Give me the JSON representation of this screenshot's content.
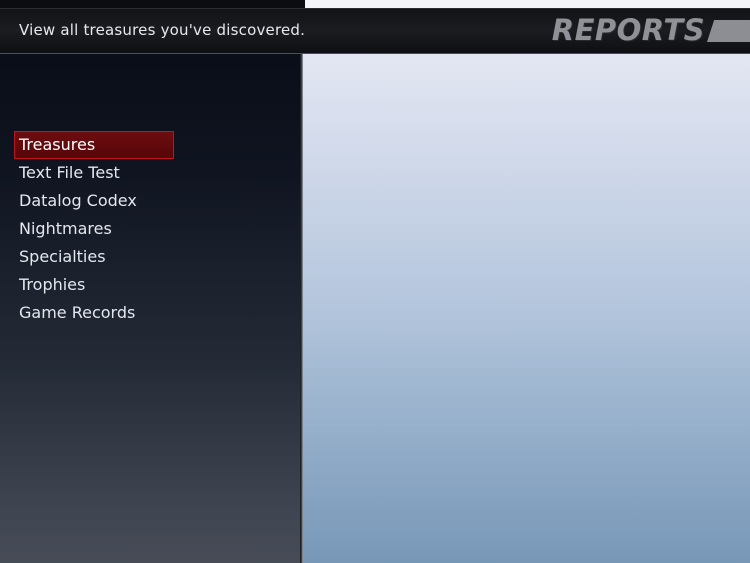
{
  "header": {
    "hint": "View all treasures you've discovered.",
    "title": "REPORTS"
  },
  "menu": {
    "items": [
      {
        "label": "Treasures",
        "selected": true
      },
      {
        "label": "Text File Test",
        "selected": false
      },
      {
        "label": "Datalog Codex",
        "selected": false
      },
      {
        "label": "Nightmares",
        "selected": false
      },
      {
        "label": "Specialties",
        "selected": false
      },
      {
        "label": "Trophies",
        "selected": false
      },
      {
        "label": "Game Records",
        "selected": false
      }
    ]
  },
  "colors": {
    "selection_fill": "#6d0c10",
    "selection_border": "#c0151b",
    "menu_text": "#e4e7ee",
    "title_text": "#8f9196"
  }
}
